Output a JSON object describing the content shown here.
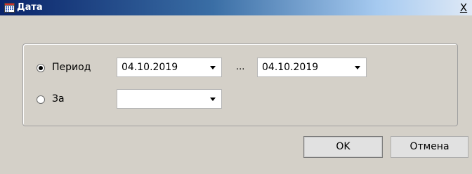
{
  "window": {
    "title": "Дата",
    "close_label": "X"
  },
  "options": [
    {
      "label": "Период",
      "checked": true
    },
    {
      "label": "За",
      "checked": false
    }
  ],
  "period": {
    "from": "04.10.2019",
    "separator": "...",
    "to": "04.10.2019"
  },
  "za": {
    "value": ""
  },
  "buttons": {
    "ok": "OK",
    "cancel": "Отмена"
  }
}
